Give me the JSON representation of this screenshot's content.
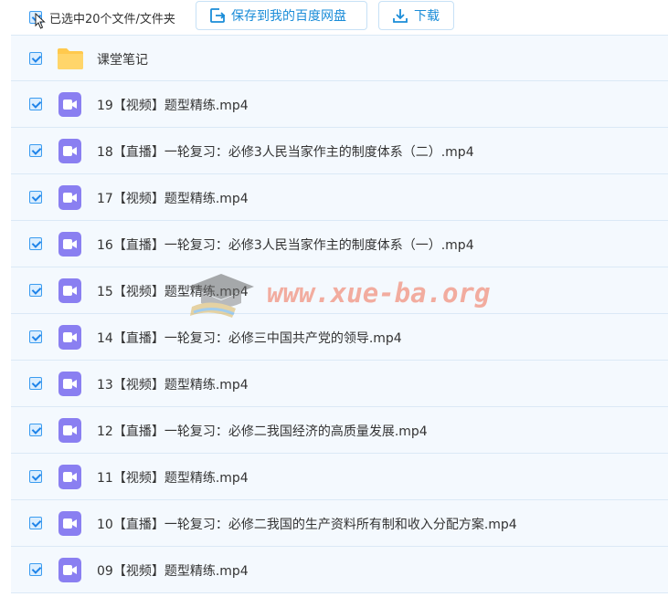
{
  "toolbar": {
    "select_label": "已选中20个文件/文件夹",
    "save_label": "保存到我的百度网盘",
    "download_label": "下载"
  },
  "files": [
    {
      "name": "课堂笔记",
      "type": "folder"
    },
    {
      "name": "19【视频】题型精练.mp4",
      "type": "video"
    },
    {
      "name": "18【直播】一轮复习：必修3人民当家作主的制度体系（二）.mp4",
      "type": "video"
    },
    {
      "name": "17【视频】题型精练.mp4",
      "type": "video"
    },
    {
      "name": "16【直播】一轮复习：必修3人民当家作主的制度体系（一）.mp4",
      "type": "video"
    },
    {
      "name": "15【视频】题型精练.mp4",
      "type": "video"
    },
    {
      "name": "14【直播】一轮复习：必修三中国共产党的领导.mp4",
      "type": "video"
    },
    {
      "name": "13【视频】题型精练.mp4",
      "type": "video"
    },
    {
      "name": "12【直播】一轮复习：必修二我国经济的高质量发展.mp4",
      "type": "video"
    },
    {
      "name": "11【视频】题型精练.mp4",
      "type": "video"
    },
    {
      "name": "10【直播】一轮复习：必修二我国的生产资料所有制和收入分配方案.mp4",
      "type": "video"
    },
    {
      "name": "09【视频】题型精练.mp4",
      "type": "video"
    }
  ],
  "watermark": {
    "text": "www.xue-ba.org"
  },
  "colors": {
    "accent": "#1a8cd8",
    "video_icon": "#8a7ff1",
    "folder": "#ffc94d",
    "row_bg": "#f4f9fe"
  }
}
